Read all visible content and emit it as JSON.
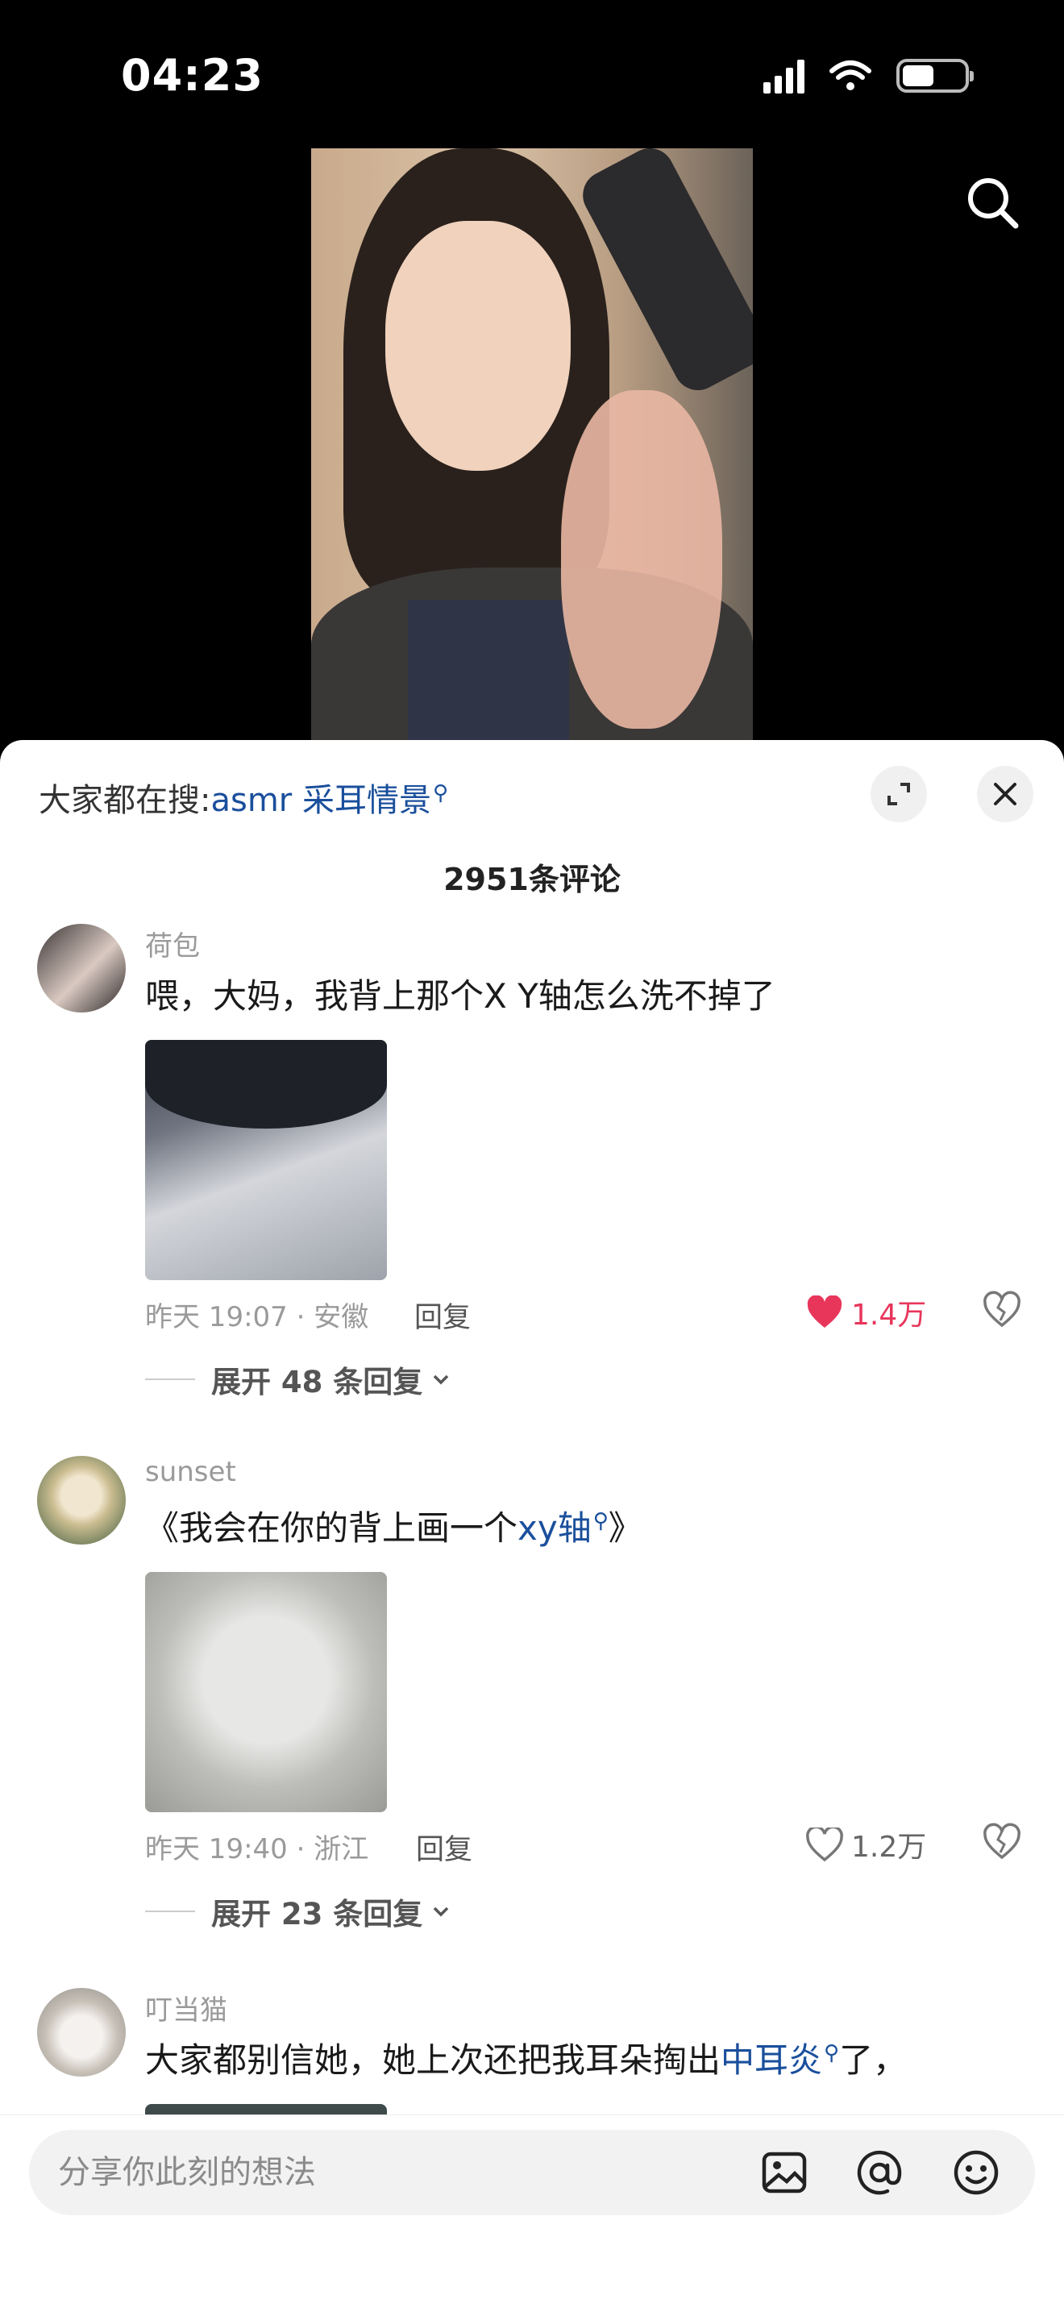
{
  "status": {
    "time": "04:23"
  },
  "trending": {
    "prefix": "大家都在搜:",
    "keyword": "asmr 采耳情景"
  },
  "comments_header": {
    "count_label": "2951条评论"
  },
  "comments": [
    {
      "username": "荷包",
      "text": "喂，大妈，我背上那个X Y轴怎么洗不掉了",
      "meta": "昨天 19:07 · 安徽",
      "reply_label": "回复",
      "likes": "1.4万",
      "liked": true,
      "expand_label": "展开 48 条回复"
    },
    {
      "username": "sunset",
      "text_before": "《我会在你的背上画一个",
      "text_keyword": "xy轴",
      "text_after": "》",
      "meta": "昨天 19:40 · 浙江",
      "reply_label": "回复",
      "likes": "1.2万",
      "liked": false,
      "expand_label": "展开 23 条回复"
    },
    {
      "username": "叮当猫",
      "text_before": "大家都别信她，她上次还把我耳朵掏出",
      "text_keyword": "中耳炎",
      "text_after": "了，"
    }
  ],
  "input": {
    "placeholder": "分享你此刻的想法"
  },
  "colors": {
    "accent_link": "#1a4f9c",
    "like_red": "#e8365b"
  }
}
